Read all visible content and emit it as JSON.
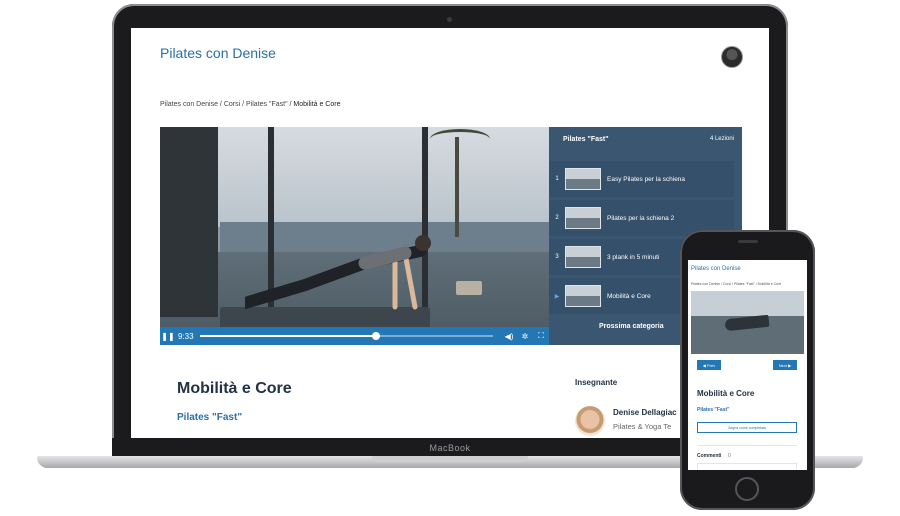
{
  "desktop": {
    "site_title": "Pilates con Denise",
    "breadcrumb": [
      "Pilates con Denise",
      "Corsi",
      "Pilates \"Fast\"",
      "Mobilità e Core"
    ],
    "breadcrumb_separator": " / ",
    "video": {
      "time": "9:33",
      "progress": 0.6,
      "controls": [
        "pause-icon",
        "volume-icon",
        "settings-icon",
        "fullscreen-icon"
      ]
    },
    "playlist": {
      "title": "Pilates \"Fast\"",
      "count": "4 Lezioni",
      "items": [
        {
          "num": "1",
          "label": "Easy Pilates per la schiena"
        },
        {
          "num": "2",
          "label": "Pilates per la schiena 2"
        },
        {
          "num": "3",
          "label": "3 plank in 5 minuti"
        },
        {
          "num": "▶",
          "label": "Mobilità e Core"
        }
      ],
      "next_label": "Prossima categoria"
    },
    "lesson_title": "Mobilità e Core",
    "course_link": "Pilates \"Fast\"",
    "teacher": {
      "section_label": "Insegnante",
      "name": "Denise Dellagiac",
      "role": "Pilates & Yoga Te"
    }
  },
  "laptop_label": "MacBook",
  "mobile": {
    "site_title": "Pilates con Denise",
    "breadcrumb": "Pilates con Denise / Corsi / Pilates \"Fast\" / Mobilità e Core",
    "prev_label": "◀ Prev",
    "next_label": "Next ▶",
    "lesson_title": "Mobilità e Core",
    "course_link": "Pilates \"Fast\"",
    "complete_label": "Segna come completata",
    "comments_label": "Commenti",
    "comments_count": "0"
  },
  "colors": {
    "accent": "#2377b5",
    "title_blue": "#2a6fa8",
    "sidebar": "#3a5670",
    "heading": "#233242"
  }
}
